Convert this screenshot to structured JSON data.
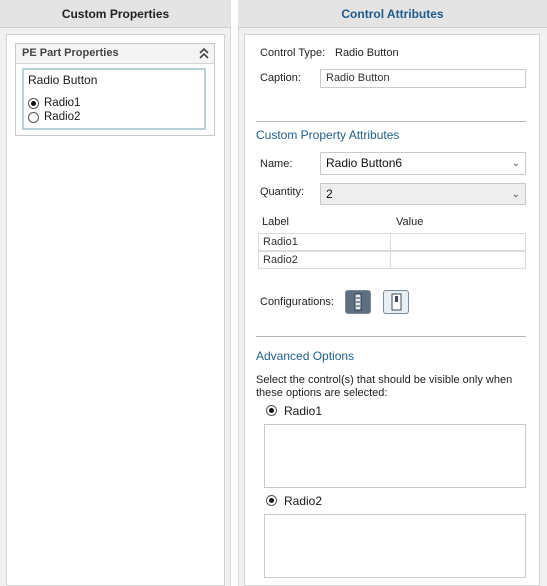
{
  "left_panel": {
    "title": "Custom Properties",
    "group": {
      "title": "PE Part Properties",
      "collapse_icon": "double-chevron-up-icon",
      "control": {
        "caption": "Radio Button",
        "options": [
          {
            "label": "Radio1",
            "selected": true
          },
          {
            "label": "Radio2",
            "selected": false
          }
        ]
      }
    }
  },
  "right_panel": {
    "title": "Control Attributes",
    "control_type": {
      "label": "Control Type:",
      "value": "Radio Button"
    },
    "caption": {
      "label": "Caption:",
      "value": "Radio Button"
    },
    "custom_property": {
      "section_title": "Custom Property Attributes",
      "name": {
        "label": "Name:",
        "value": "Radio Button6"
      },
      "quantity": {
        "label": "Quantity:",
        "value": "2"
      },
      "grid": {
        "headers": [
          "Label",
          "Value"
        ],
        "rows": [
          [
            "Radio1",
            ""
          ],
          [
            "Radio2",
            ""
          ]
        ]
      },
      "configurations": {
        "label": "Configurations:",
        "buttons": [
          {
            "icon": "all-configurations-icon",
            "active": true
          },
          {
            "icon": "single-configuration-icon",
            "active": false
          }
        ]
      }
    },
    "advanced": {
      "section_title": "Advanced Options",
      "description": "Select the control(s) that should be visible only when these options are selected:",
      "options": [
        {
          "label": "Radio1",
          "selected": true
        },
        {
          "label": "Radio2",
          "selected": true
        }
      ]
    }
  },
  "colors": {
    "accent": "#1f5f8b",
    "panel_bg": "#f0f0f0",
    "header_bg": "#e4e4e4",
    "frame_border": "#b8d0d6"
  }
}
